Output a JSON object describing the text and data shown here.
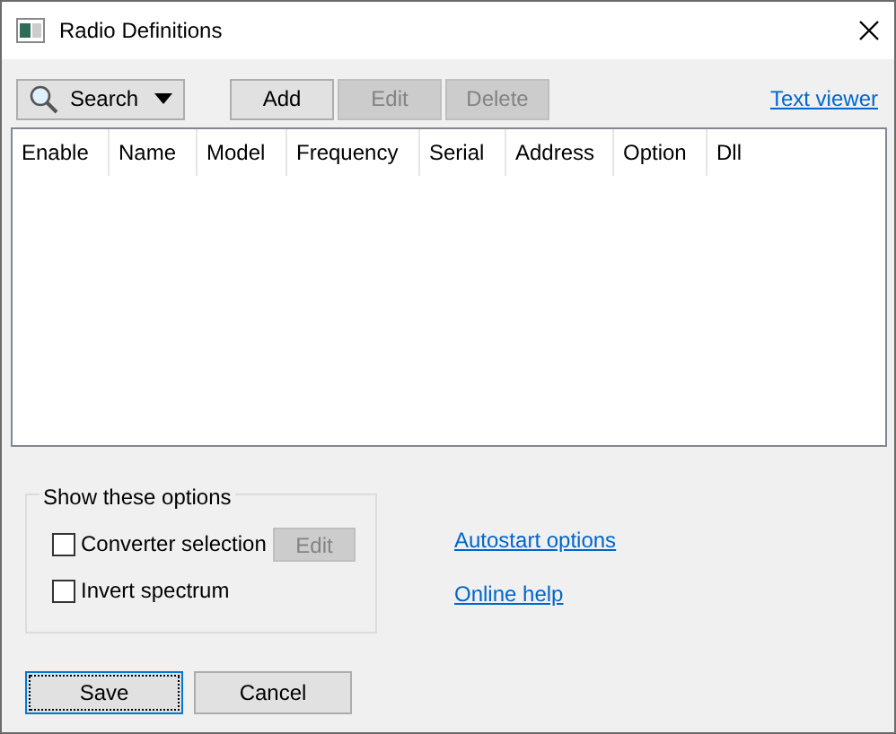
{
  "window": {
    "title": "Radio Definitions"
  },
  "toolbar": {
    "search_button": "Search",
    "buttons": [
      {
        "label": "Add",
        "disabled": false
      },
      {
        "label": "Edit",
        "disabled": true
      },
      {
        "label": "Delete",
        "disabled": true
      }
    ],
    "link": "Text viewer"
  },
  "table": {
    "columns": [
      "Enable",
      "Name",
      "Model",
      "Frequency",
      "Serial",
      "Address",
      "Option",
      "Dll"
    ]
  },
  "options_group": {
    "title": "Show these options",
    "options": [
      {
        "label": "Converter selection",
        "checked": false,
        "edit_button": {
          "label": "Edit",
          "disabled": true
        }
      },
      {
        "label": "Invert spectrum",
        "checked": false
      }
    ]
  },
  "links": [
    "Autostart options",
    "Online help"
  ],
  "buttons": [
    {
      "label": "Save",
      "focused": true
    },
    {
      "label": "Cancel",
      "focused": false
    }
  ]
}
